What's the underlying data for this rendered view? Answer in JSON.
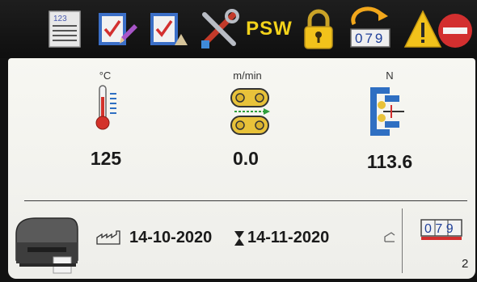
{
  "toolbar": {
    "icons": [
      "numbered-list-icon",
      "checklist-edit-icon",
      "checklist-icon",
      "tools-icon",
      "password-icon",
      "padlock-icon",
      "counter-reset-icon",
      "warning-stop-icon"
    ],
    "psw_label": "PSW",
    "list_icon_text": "123",
    "counter_icon_digits": "079"
  },
  "metrics": {
    "temperature": {
      "unit": "°C",
      "value": "125",
      "icon": "thermometer-icon"
    },
    "speed": {
      "unit": "m/min",
      "value": "0.0",
      "icon": "conveyor-rollers-icon"
    },
    "force": {
      "unit": "N",
      "value": "113.6",
      "icon": "clamp-force-icon"
    }
  },
  "status": {
    "printer_icon": "label-printer-icon",
    "start_date": "14-10-2020",
    "end_date": "14-11-2020",
    "start_icon": "factory-icon",
    "end_icon": "hourglass-icon",
    "small_icon": "ramp-icon",
    "counter_digits": "079",
    "page_number": "2"
  },
  "colors": {
    "toolbar_bg": "#121212",
    "screen_bg": "#f4f4ef",
    "psw_yellow": "#f2d21b",
    "thermo_red": "#d3322a",
    "roller_yellow": "#e8c23a",
    "clamp_blue": "#2f6fc2",
    "warning_yellow": "#f2c21b",
    "stop_red": "#d32f2f"
  }
}
